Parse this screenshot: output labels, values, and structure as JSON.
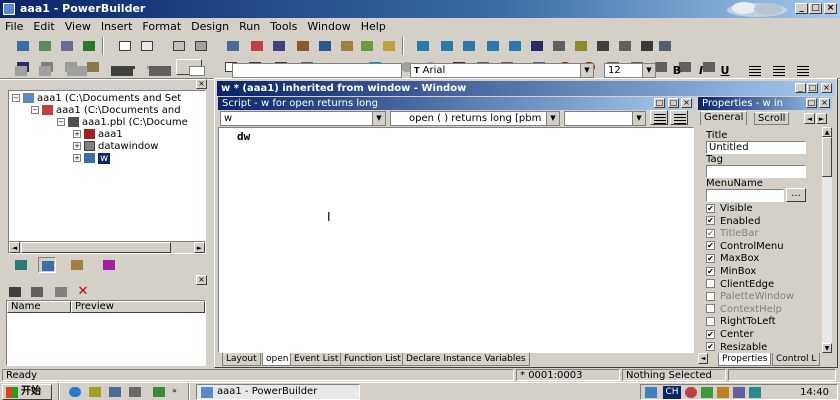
{
  "window": {
    "title": "aaa1 - PowerBuilder"
  },
  "menu": [
    "File",
    "Edit",
    "View",
    "Insert",
    "Format",
    "Design",
    "Run",
    "Tools",
    "Window",
    "Help"
  ],
  "format_bar": {
    "font": "Arial",
    "size": "12",
    "bold": "B",
    "italic": "I",
    "underline": "U"
  },
  "system_tree": {
    "items": [
      {
        "label": "aaa1 (C:\\Documents and Set",
        "indent": 0
      },
      {
        "label": "aaa1 (C:\\Documents and",
        "indent": 1
      },
      {
        "label": "aaa1.pbl (C:\\Docume",
        "indent": 2
      },
      {
        "label": "aaa1",
        "indent": 3
      },
      {
        "label": "datawindow",
        "indent": 3
      },
      {
        "label": "w",
        "indent": 3
      }
    ]
  },
  "clip_pane": {
    "col_name": "Name",
    "col_preview": "Preview"
  },
  "painter": {
    "title": "w * (aaa1) inherited from window - Window",
    "script_title": "Script - w for open returns long",
    "object_combo": "w",
    "event_combo": "open ( )  returns long [pbm",
    "code": "dw",
    "tabs": [
      "Layout",
      "open",
      "Event List",
      "Function List",
      "Declare Instance Variables"
    ]
  },
  "properties": {
    "title": "Properties - w in",
    "tabs": [
      "General",
      "Scroll"
    ],
    "title_label": "Title",
    "title_value": "Untitled",
    "tag_label": "Tag",
    "tag_value": "",
    "menuname_label": "MenuName",
    "menuname_value": "",
    "browse_label": "...",
    "checks": [
      {
        "label": "Visible",
        "checked": true,
        "enabled": true
      },
      {
        "label": "Enabled",
        "checked": true,
        "enabled": true
      },
      {
        "label": "TitleBar",
        "checked": true,
        "enabled": false
      },
      {
        "label": "ControlMenu",
        "checked": true,
        "enabled": true
      },
      {
        "label": "MaxBox",
        "checked": true,
        "enabled": true
      },
      {
        "label": "MinBox",
        "checked": true,
        "enabled": true
      },
      {
        "label": "ClientEdge",
        "checked": false,
        "enabled": true
      },
      {
        "label": "PaletteWindow",
        "checked": false,
        "enabled": false
      },
      {
        "label": "ContextHelp",
        "checked": false,
        "enabled": false
      },
      {
        "label": "RightToLeft",
        "checked": false,
        "enabled": true
      },
      {
        "label": "Center",
        "checked": true,
        "enabled": true
      },
      {
        "label": "Resizable",
        "checked": true,
        "enabled": true
      }
    ],
    "bottom_tabs": [
      "Properties",
      "Control L"
    ]
  },
  "status": {
    "text": "Ready",
    "position": "0001:0003",
    "selection": "Nothing Selected"
  },
  "taskbar": {
    "start": "开始",
    "task": "aaa1 - PowerBuilder",
    "lang": "CH",
    "clock": "14:40"
  },
  "colors": {
    "titlebar": "#0a246a",
    "face": "#d4d0c8",
    "select": "#0a246a"
  }
}
